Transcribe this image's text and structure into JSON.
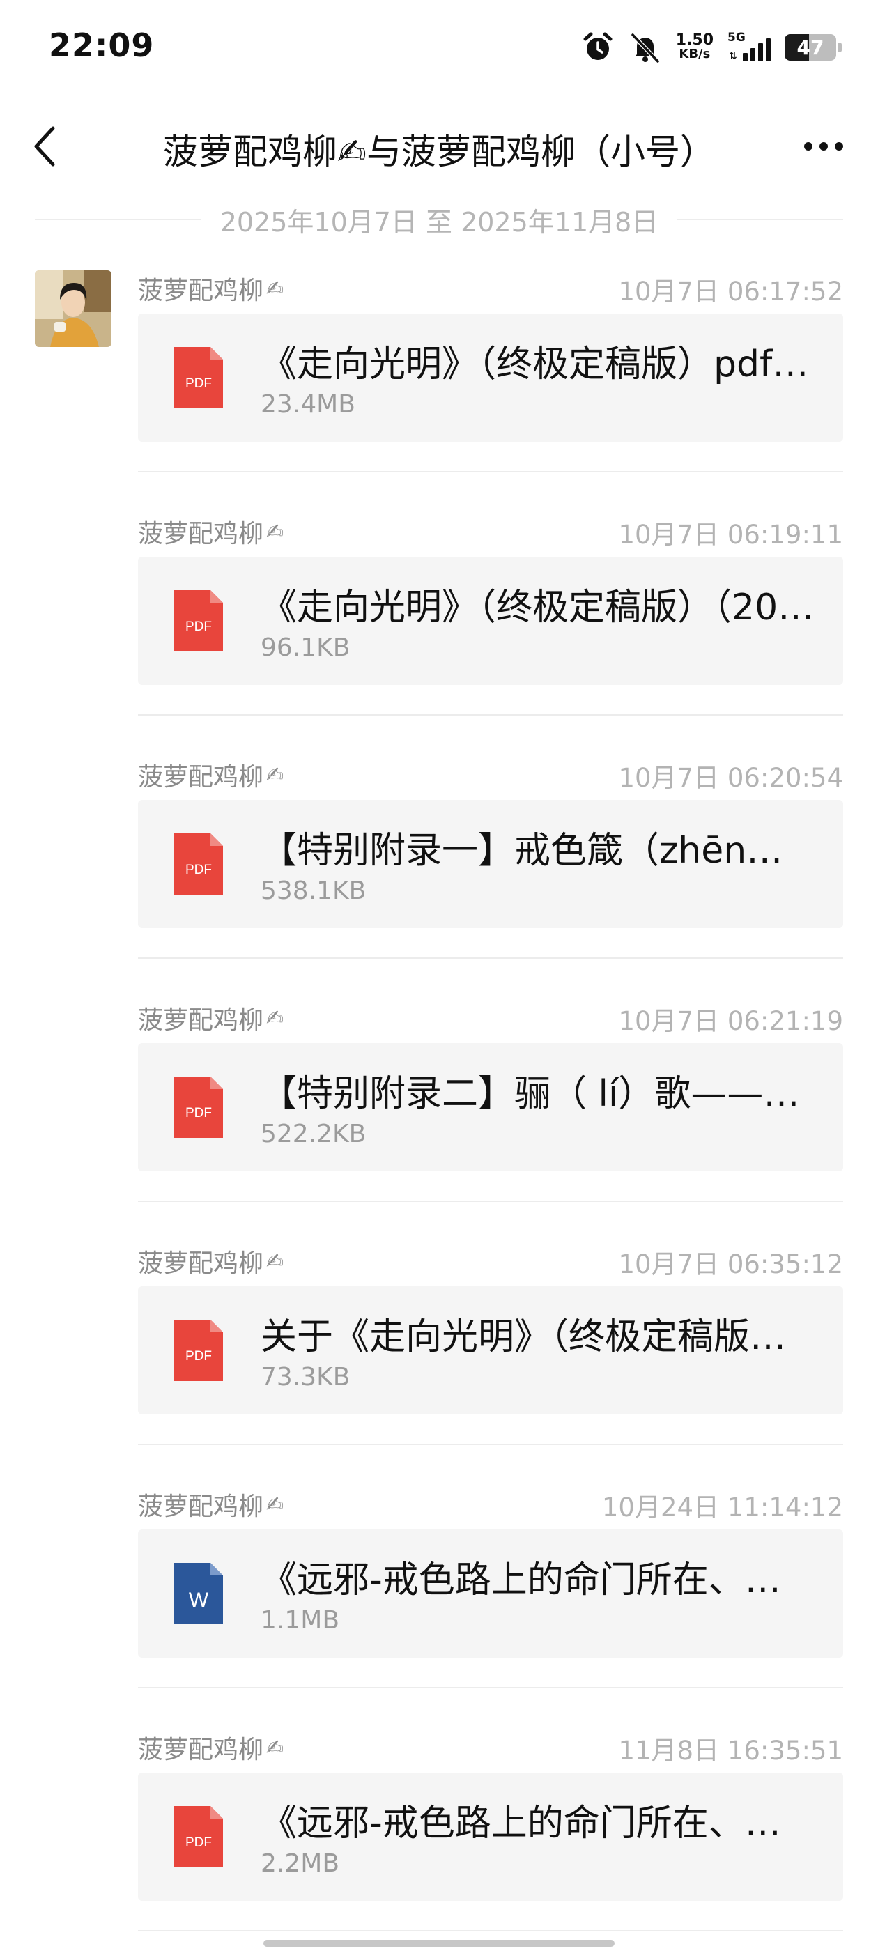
{
  "status_bar": {
    "time": "22:09",
    "net_speed_value": "1.50",
    "net_speed_unit": "KB/s",
    "network": "5G",
    "battery": "47"
  },
  "header": {
    "title": "菠萝配鸡柳✍与菠萝配鸡柳（小号）"
  },
  "date_range": "2025年10月7日 至 2025年11月8日",
  "messages": [
    {
      "sender": "菠萝配鸡柳",
      "sig": "✍",
      "time": "10月7日 06:17:52",
      "file_type": "PDF",
      "file_name": "《走向光明》（终极定稿版）pdf…",
      "file_size": "23.4MB"
    },
    {
      "sender": "菠萝配鸡柳",
      "sig": "✍",
      "time": "10月7日 06:19:11",
      "file_type": "PDF",
      "file_name": "《走向光明》（终极定稿版）（20…",
      "file_size": "96.1KB"
    },
    {
      "sender": "菠萝配鸡柳",
      "sig": "✍",
      "time": "10月7日 06:20:54",
      "file_type": "PDF",
      "file_name": "【特别附录一】戒色箴（zhēn）言…",
      "file_size": "538.1KB"
    },
    {
      "sender": "菠萝配鸡柳",
      "sig": "✍",
      "time": "10月7日 06:21:19",
      "file_type": "PDF",
      "file_name": "【特别附录二】骊（ lí）歌——致…",
      "file_size": "522.2KB"
    },
    {
      "sender": "菠萝配鸡柳",
      "sig": "✍",
      "time": "10月7日 06:35:12",
      "file_type": "PDF",
      "file_name": "关于《走向光明》（终极定稿版）…",
      "file_size": "73.3KB"
    },
    {
      "sender": "菠萝配鸡柳",
      "sig": "✍",
      "time": "10月24日 11:14:12",
      "file_type": "W",
      "file_name": "《远邪-戒色路上的命门所在、…",
      "file_size": "1.1MB"
    },
    {
      "sender": "菠萝配鸡柳",
      "sig": "✍",
      "time": "11月8日 16:35:51",
      "file_type": "PDF",
      "file_name": "《远邪-戒色路上的命门所在、…",
      "file_size": "2.2MB"
    }
  ],
  "colors": {
    "pdf_icon": "#e8453c",
    "word_icon": "#2b579a",
    "card_bg": "#f5f5f5"
  }
}
